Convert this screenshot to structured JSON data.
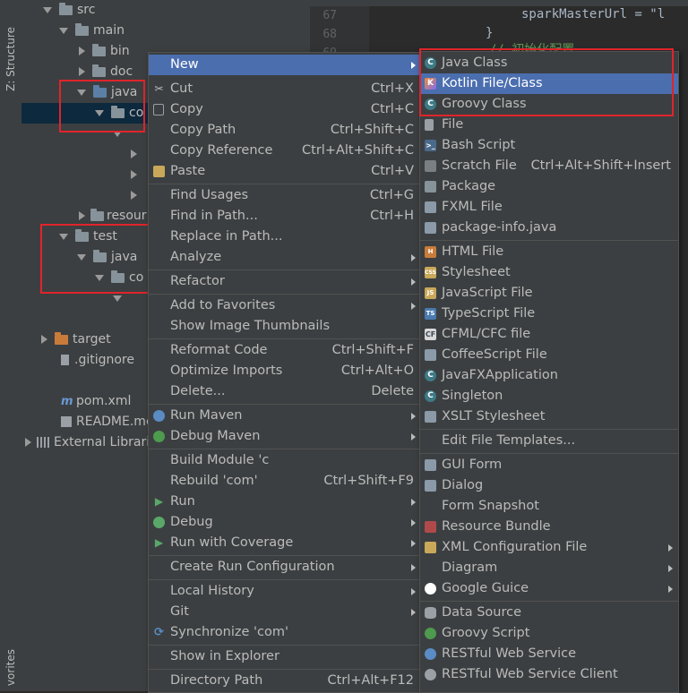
{
  "left_strip": {
    "structure_label": "Z: Structure",
    "favorites_label": "vorites"
  },
  "tree": {
    "rows": [
      {
        "label": "src"
      },
      {
        "label": "main"
      },
      {
        "label": "bin"
      },
      {
        "label": "doc"
      },
      {
        "label": "java"
      },
      {
        "label": "co"
      },
      {
        "label": "resour"
      },
      {
        "label": "test"
      },
      {
        "label": "java"
      },
      {
        "label": "co"
      },
      {
        "label": "target"
      },
      {
        "label": ".gitignore"
      },
      {
        "label": "pom.xml"
      },
      {
        "label": "README.mc"
      },
      {
        "label": "External Librari"
      }
    ]
  },
  "editor": {
    "lines": [
      {
        "num": "67",
        "code": "sparkMasterUrl = \"l"
      },
      {
        "num": "68",
        "code": "}"
      },
      {
        "num": "69",
        "code": "// 初始化配置"
      }
    ]
  },
  "context_menu": {
    "items": [
      {
        "label": "New",
        "shortcut": "",
        "submenu": true
      },
      {
        "label": "Cut",
        "shortcut": "Ctrl+X",
        "icon": "cut-icon"
      },
      {
        "label": "Copy",
        "shortcut": "Ctrl+C",
        "icon": "copy-icon"
      },
      {
        "label": "Copy Path",
        "shortcut": "Ctrl+Shift+C"
      },
      {
        "label": "Copy Reference",
        "shortcut": "Ctrl+Alt+Shift+C"
      },
      {
        "label": "Paste",
        "shortcut": "Ctrl+V",
        "icon": "paste-icon"
      },
      {
        "label": "Find Usages",
        "shortcut": "Ctrl+G"
      },
      {
        "label": "Find in Path...",
        "shortcut": "Ctrl+H"
      },
      {
        "label": "Replace in Path...",
        "shortcut": ""
      },
      {
        "label": "Analyze",
        "shortcut": "",
        "submenu": true
      },
      {
        "label": "Refactor",
        "shortcut": "",
        "submenu": true
      },
      {
        "label": "Add to Favorites",
        "shortcut": "",
        "submenu": true
      },
      {
        "label": "Show Image Thumbnails",
        "shortcut": ""
      },
      {
        "label": "Reformat Code",
        "shortcut": "Ctrl+Shift+F"
      },
      {
        "label": "Optimize Imports",
        "shortcut": "Ctrl+Alt+O"
      },
      {
        "label": "Delete...",
        "shortcut": "Delete"
      },
      {
        "label": "Run Maven",
        "shortcut": "",
        "submenu": true,
        "icon": "maven-icon"
      },
      {
        "label": "Debug Maven",
        "shortcut": "",
        "submenu": true,
        "icon": "maven-debug-icon"
      },
      {
        "label": "Build Module 'c",
        "shortcut": ""
      },
      {
        "label": "Rebuild 'com'",
        "shortcut": "Ctrl+Shift+F9"
      },
      {
        "label": "Run",
        "shortcut": "",
        "submenu": true,
        "icon": "run-icon"
      },
      {
        "label": "Debug",
        "shortcut": "",
        "submenu": true,
        "icon": "debug-icon"
      },
      {
        "label": "Run with Coverage",
        "shortcut": "",
        "submenu": true,
        "icon": "coverage-icon"
      },
      {
        "label": "Create Run Configuration",
        "shortcut": "",
        "submenu": true
      },
      {
        "label": "Local History",
        "shortcut": "",
        "submenu": true
      },
      {
        "label": "Git",
        "shortcut": "",
        "submenu": true
      },
      {
        "label": "Synchronize 'com'",
        "shortcut": "",
        "icon": "sync-icon"
      },
      {
        "label": "Show in Explorer",
        "shortcut": ""
      },
      {
        "label": "Directory Path",
        "shortcut": "Ctrl+Alt+F12"
      }
    ]
  },
  "new_submenu": {
    "items": [
      {
        "label": "Java Class",
        "shortcut": ""
      },
      {
        "label": "Kotlin File/Class",
        "shortcut": ""
      },
      {
        "label": "Groovy Class",
        "shortcut": ""
      },
      {
        "label": "File",
        "shortcut": ""
      },
      {
        "label": "Bash Script",
        "shortcut": ""
      },
      {
        "label": "Scratch File",
        "shortcut": "Ctrl+Alt+Shift+Insert"
      },
      {
        "label": "Package",
        "shortcut": ""
      },
      {
        "label": "FXML File",
        "shortcut": ""
      },
      {
        "label": "package-info.java",
        "shortcut": ""
      },
      {
        "label": "HTML File",
        "shortcut": ""
      },
      {
        "label": "Stylesheet",
        "shortcut": ""
      },
      {
        "label": "JavaScript File",
        "shortcut": ""
      },
      {
        "label": "TypeScript File",
        "shortcut": ""
      },
      {
        "label": "CFML/CFC file",
        "shortcut": ""
      },
      {
        "label": "CoffeeScript File",
        "shortcut": ""
      },
      {
        "label": "JavaFXApplication",
        "shortcut": ""
      },
      {
        "label": "Singleton",
        "shortcut": ""
      },
      {
        "label": "XSLT Stylesheet",
        "shortcut": ""
      },
      {
        "label": "Edit File Templates...",
        "shortcut": ""
      },
      {
        "label": "GUI Form",
        "shortcut": ""
      },
      {
        "label": "Dialog",
        "shortcut": ""
      },
      {
        "label": "Form Snapshot",
        "shortcut": ""
      },
      {
        "label": "Resource Bundle",
        "shortcut": ""
      },
      {
        "label": "XML Configuration File",
        "shortcut": "",
        "submenu": true
      },
      {
        "label": "Diagram",
        "shortcut": "",
        "submenu": true
      },
      {
        "label": "Google Guice",
        "shortcut": "",
        "submenu": true
      },
      {
        "label": "Data Source",
        "shortcut": ""
      },
      {
        "label": "Groovy Script",
        "shortcut": ""
      },
      {
        "label": "RESTful Web Service",
        "shortcut": ""
      },
      {
        "label": "RESTful Web Service Client",
        "shortcut": ""
      }
    ]
  },
  "colors": {
    "highlight": "#4b6eaf",
    "annotation_red": "#e0242b",
    "panel_bg": "#3c3f41",
    "editor_bg": "#2b2b2b"
  }
}
